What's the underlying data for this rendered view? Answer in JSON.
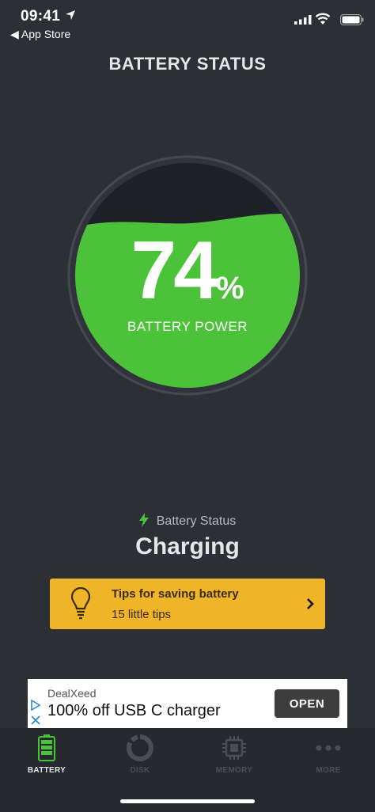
{
  "status_bar": {
    "time": "09:41",
    "back_label": "App Store"
  },
  "header": {
    "title": "BATTERY STATUS"
  },
  "gauge": {
    "percent": "74",
    "percent_sign": "%",
    "label": "BATTERY POWER",
    "fill_color": "#4cc13a"
  },
  "status": {
    "label": "Battery Status",
    "value": "Charging"
  },
  "tips": {
    "title": "Tips for saving battery",
    "subtitle": "15 little tips",
    "color": "#f0b429"
  },
  "ad": {
    "brand": "DealXeed",
    "headline": "100% off USB C charger",
    "button": "OPEN"
  },
  "tabs": [
    {
      "label": "BATTERY",
      "icon": "battery-icon",
      "active": true
    },
    {
      "label": "DISK",
      "icon": "disk-icon",
      "active": false
    },
    {
      "label": "MEMORY",
      "icon": "chip-icon",
      "active": false
    },
    {
      "label": "MORE",
      "icon": "more-icon",
      "active": false
    }
  ]
}
